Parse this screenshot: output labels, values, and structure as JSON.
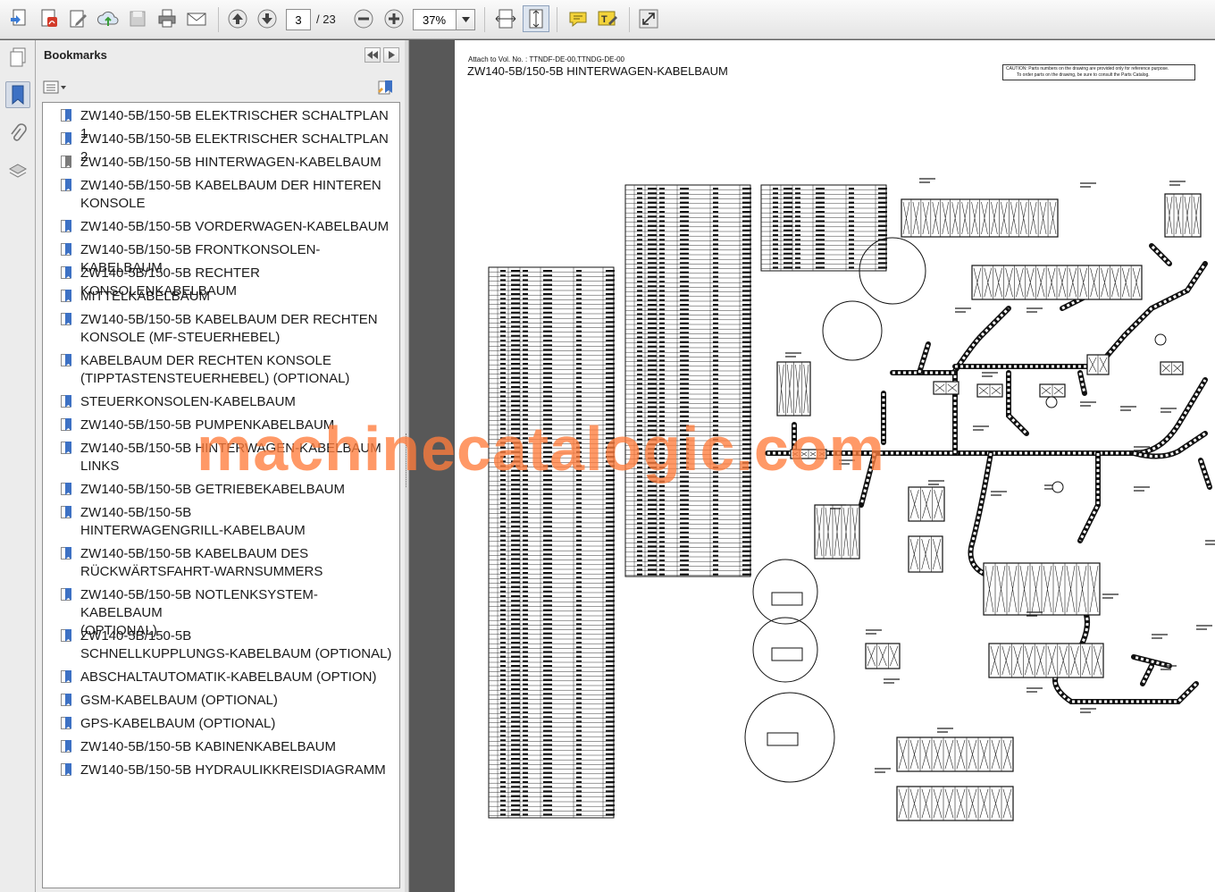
{
  "toolbar": {
    "current_page": "3",
    "page_total": "/ 23",
    "zoom": "37%",
    "icons": [
      "create-icon",
      "export-pdf-icon",
      "edit-icon",
      "upload-icon",
      "save-icon",
      "print-icon",
      "email-icon",
      "previous-page-icon",
      "next-page-icon",
      "zoom-out-icon",
      "zoom-in-icon",
      "fit-width-icon",
      "fit-page-icon",
      "comment-icon",
      "highlight-icon",
      "fullscreen-icon"
    ]
  },
  "rail": {
    "icons": [
      "pages-icon",
      "bookmarks-icon",
      "attachments-icon",
      "layers-icon"
    ],
    "active": "bookmarks-icon"
  },
  "panel": {
    "title": "Bookmarks",
    "bookmarks": [
      "ZW140-5B/150-5B ELEKTRISCHER SCHALTPLAN 1",
      "ZW140-5B/150-5B ELEKTRISCHER SCHALTPLAN 2",
      "ZW140-5B/150-5B HINTERWAGEN-KABELBAUM",
      "ZW140-5B/150-5B KABELBAUM DER HINTEREN KONSOLE",
      "ZW140-5B/150-5B VORDERWAGEN-KABELBAUM",
      "ZW140-5B/150-5B FRONTKONSOLEN-KABELBAUM",
      "ZW140-5B/150-5B RECHTER KONSOLENKABELBAUM",
      "MITTELKABELBAUM",
      "ZW140-5B/150-5B KABELBAUM DER RECHTEN KONSOLE (MF-STEUERHEBEL)",
      "KABELBAUM DER RECHTEN KONSOLE (TIPPTASTENSTEUERHEBEL) (OPTIONAL)",
      "STEUERKONSOLEN-KABELBAUM",
      "ZW140-5B/150-5B PUMPENKABELBAUM",
      "ZW140-5B/150-5B HINTERWAGEN-KABELBAUM LINKS",
      "ZW140-5B/150-5B GETRIEBEKABELBAUM",
      "ZW140-5B/150-5B HINTERWAGENGRILL-KABELBAUM",
      "ZW140-5B/150-5B KABELBAUM DES RÜCKWÄRTSFAHRT-WARNSUMMERS",
      "ZW140-5B/150-5B NOTLENKSYSTEM-KABELBAUM (OPTIONAL)",
      "ZW140-5B/150-5B SCHNELLKUPPLUNGS-KABELBAUM (OPTIONAL)",
      "ABSCHALTAUTOMATIK-KABELBAUM (OPTION)",
      "GSM-KABELBAUM (OPTIONAL)",
      "GPS-KABELBAUM (OPTIONAL)",
      "ZW140-5B/150-5B KABINENKABELBAUM",
      "ZW140-5B/150-5B HYDRAULIKKREISDIAGRAMM"
    ],
    "bookmark_lines": [
      [
        "ZW140-5B/150-5B ELEKTRISCHER SCHALTPLAN 1"
      ],
      [
        "ZW140-5B/150-5B ELEKTRISCHER SCHALTPLAN 2"
      ],
      [
        "ZW140-5B/150-5B HINTERWAGEN-KABELBAUM"
      ],
      [
        "ZW140-5B/150-5B KABELBAUM DER HINTEREN",
        "KONSOLE"
      ],
      [
        "ZW140-5B/150-5B VORDERWAGEN-KABELBAUM"
      ],
      [
        "ZW140-5B/150-5B FRONTKONSOLEN-KABELBAUM"
      ],
      [
        "ZW140-5B/150-5B RECHTER KONSOLENKABELBAUM"
      ],
      [
        "MITTELKABELBAUM"
      ],
      [
        "ZW140-5B/150-5B KABELBAUM DER RECHTEN",
        "KONSOLE (MF-STEUERHEBEL)"
      ],
      [
        "KABELBAUM DER RECHTEN KONSOLE",
        "(TIPPTASTENSTEUERHEBEL) (OPTIONAL)"
      ],
      [
        "STEUERKONSOLEN-KABELBAUM"
      ],
      [
        "ZW140-5B/150-5B PUMPENKABELBAUM"
      ],
      [
        "ZW140-5B/150-5B HINTERWAGEN-KABELBAUM",
        "LINKS"
      ],
      [
        "ZW140-5B/150-5B GETRIEBEKABELBAUM"
      ],
      [
        "ZW140-5B/150-5B",
        "HINTERWAGENGRILL-KABELBAUM"
      ],
      [
        "ZW140-5B/150-5B KABELBAUM DES",
        "RÜCKWÄRTSFAHRT-WARNSUMMERS"
      ],
      [
        "ZW140-5B/150-5B NOTLENKSYSTEM-KABELBAUM",
        "(OPTIONAL)"
      ],
      [
        "ZW140-5B/150-5B",
        "SCHNELLKUPPLUNGS-KABELBAUM (OPTIONAL)"
      ],
      [
        "ABSCHALTAUTOMATIK-KABELBAUM (OPTION)"
      ],
      [
        "GSM-KABELBAUM (OPTIONAL)"
      ],
      [
        "GPS-KABELBAUM (OPTIONAL)"
      ],
      [
        "ZW140-5B/150-5B KABINENKABELBAUM"
      ],
      [
        "ZW140-5B/150-5B HYDRAULIKKREISDIAGRAMM"
      ]
    ],
    "selected_index": 2
  },
  "document": {
    "attach_line": "Attach to Vol. No. : TTNDF-DE-00,TTNDG-DE-00",
    "title": "ZW140-5B/150-5B HINTERWAGEN-KABELBAUM",
    "caution_line1": "CAUTION: Parts numbers on the drawing are provided only for reference purpose.",
    "caution_line2": "To order parts on the drawing, be sure to consult the Parts Catalog.",
    "watermark": "machinecatalogic.com"
  }
}
